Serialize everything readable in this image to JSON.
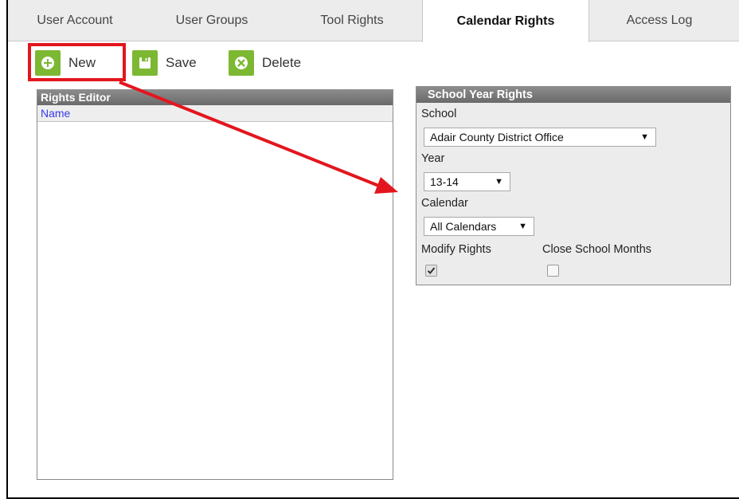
{
  "tabs": [
    {
      "label": "User Account",
      "active": false
    },
    {
      "label": "User Groups",
      "active": false
    },
    {
      "label": "Tool Rights",
      "active": false
    },
    {
      "label": "Calendar Rights",
      "active": true
    },
    {
      "label": "Access Log",
      "active": false
    }
  ],
  "toolbar": {
    "new_label": "New",
    "save_label": "Save",
    "delete_label": "Delete"
  },
  "rights_editor": {
    "title": "Rights Editor",
    "column_header": "Name",
    "rows": []
  },
  "school_year_rights": {
    "title": "School Year Rights",
    "school_label": "School",
    "school_value": "Adair County District Office",
    "year_label": "Year",
    "year_value": "13-14",
    "calendar_label": "Calendar",
    "calendar_value": "All Calendars",
    "modify_rights_label": "Modify Rights",
    "modify_rights_checked": true,
    "close_months_label": "Close School Months",
    "close_months_checked": false
  },
  "colors": {
    "accent_green": "#7cb832",
    "highlight_red": "#e3161e",
    "link_blue": "#3a3af0",
    "panel_header": "#7a7a7a"
  }
}
